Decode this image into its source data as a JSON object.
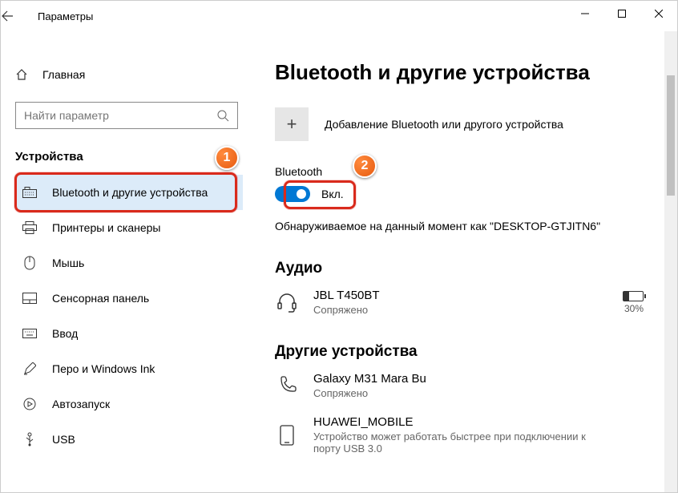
{
  "window": {
    "title": "Параметры"
  },
  "sidebar": {
    "home": "Главная",
    "search_placeholder": "Найти параметр",
    "group": "Устройства",
    "items": [
      {
        "label": "Bluetooth и другие устройства"
      },
      {
        "label": "Принтеры и сканеры"
      },
      {
        "label": "Мышь"
      },
      {
        "label": "Сенсорная панель"
      },
      {
        "label": "Ввод"
      },
      {
        "label": "Перо и Windows Ink"
      },
      {
        "label": "Автозапуск"
      },
      {
        "label": "USB"
      }
    ]
  },
  "content": {
    "heading": "Bluetooth и другие устройства",
    "add_device": "Добавление Bluetooth или другого устройства",
    "bt_label": "Bluetooth",
    "bt_state": "Вкл.",
    "discoverable": "Обнаруживаемое на данный момент как \"DESKTOP-GTJITN6\"",
    "audio_heading": "Аудио",
    "audio_device": {
      "name": "JBL T450BT",
      "status": "Сопряжено",
      "battery": "30%"
    },
    "other_heading": "Другие устройства",
    "other_devices": [
      {
        "name": "Galaxy M31 Mara Bu",
        "status": "Сопряжено"
      },
      {
        "name": "HUAWEI_MOBILE",
        "status": "Устройство может работать быстрее при подключении к порту USB 3.0"
      }
    ]
  },
  "callouts": {
    "1": "1",
    "2": "2"
  }
}
